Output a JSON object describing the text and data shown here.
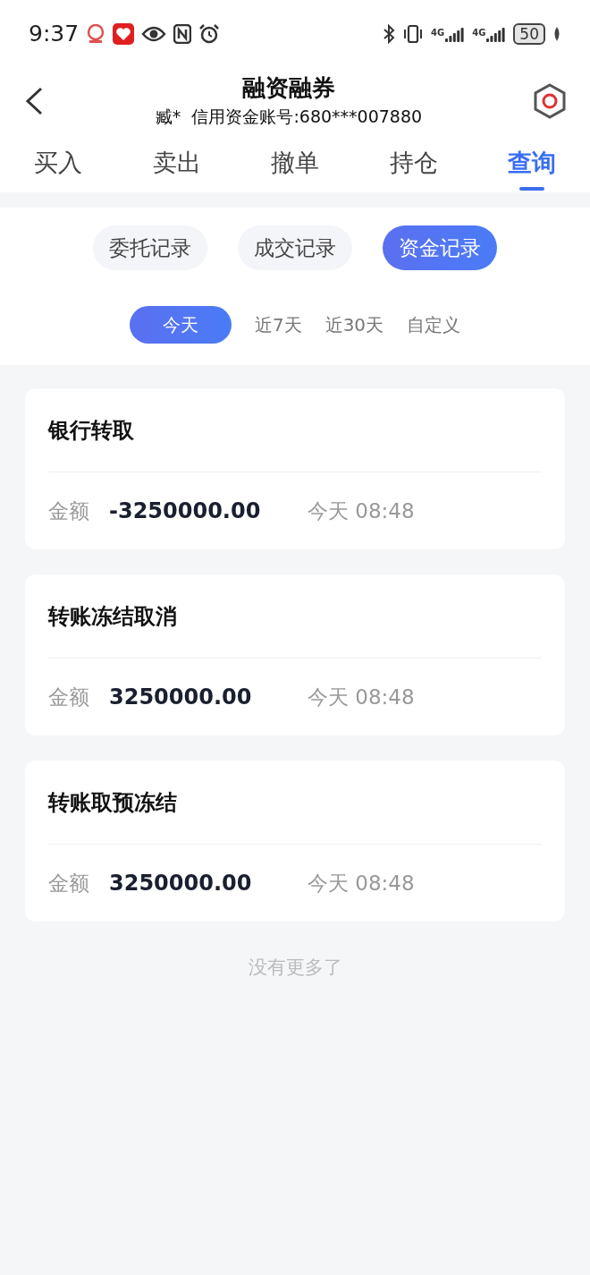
{
  "status_bar": {
    "time": "9:37",
    "network_labels": [
      "4G",
      "4G"
    ],
    "battery": "50"
  },
  "header": {
    "title": "融资融券",
    "subtitle": "臧*  信用资金账号:680***007880"
  },
  "tabs": [
    {
      "label": "买入",
      "selected": false
    },
    {
      "label": "卖出",
      "selected": false
    },
    {
      "label": "撤单",
      "selected": false
    },
    {
      "label": "持仓",
      "selected": false
    },
    {
      "label": "查询",
      "selected": true
    }
  ],
  "record_types": [
    {
      "label": "委托记录",
      "selected": false
    },
    {
      "label": "成交记录",
      "selected": false
    },
    {
      "label": "资金记录",
      "selected": true
    }
  ],
  "periods": [
    {
      "label": "今天",
      "selected": true
    },
    {
      "label": "近7天",
      "selected": false
    },
    {
      "label": "近30天",
      "selected": false
    },
    {
      "label": "自定义",
      "selected": false
    }
  ],
  "records": [
    {
      "title": "银行转取",
      "amount_label": "金额",
      "amount": "-3250000.00",
      "time": "今天 08:48"
    },
    {
      "title": "转账冻结取消",
      "amount_label": "金额",
      "amount": "3250000.00",
      "time": "今天 08:48"
    },
    {
      "title": "转账取预冻结",
      "amount_label": "金额",
      "amount": "3250000.00",
      "time": "今天 08:48"
    }
  ],
  "end_note": "没有更多了"
}
